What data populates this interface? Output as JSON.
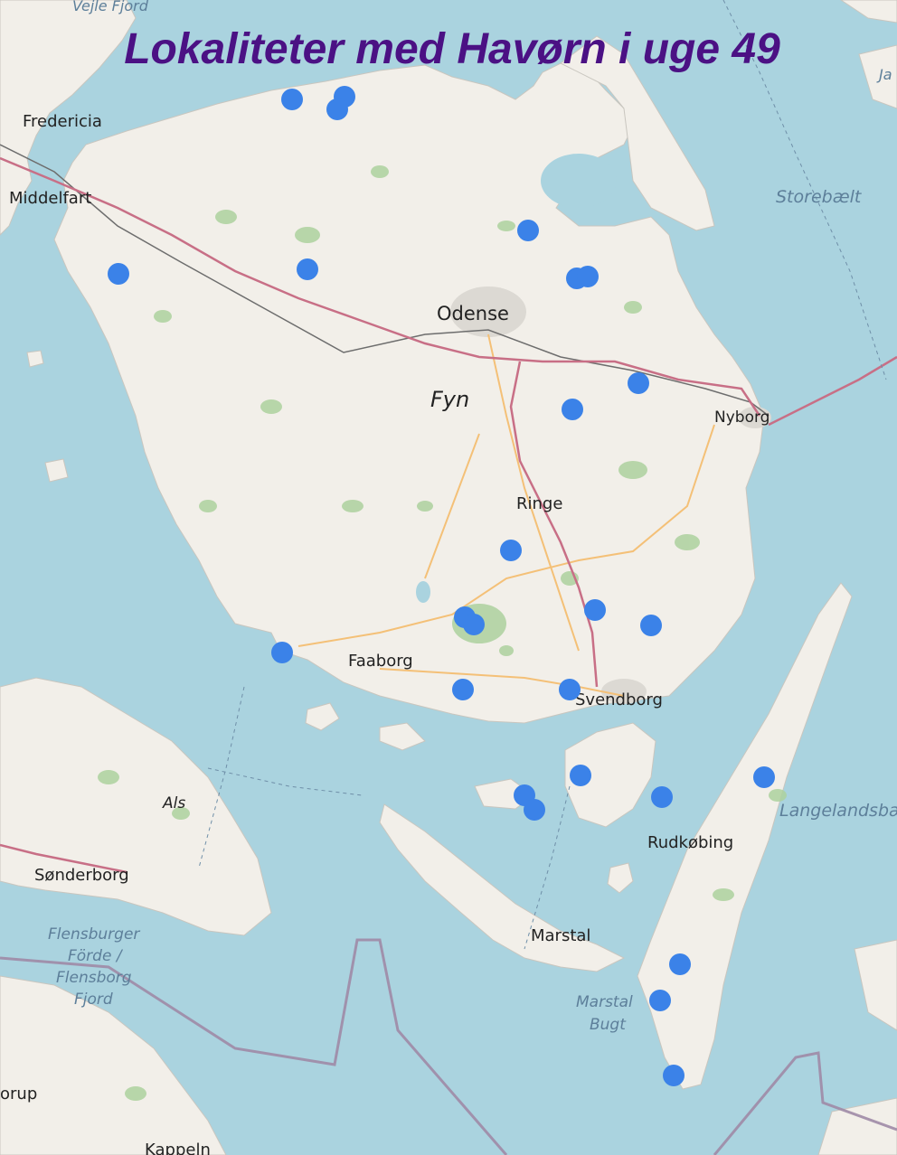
{
  "title": "Lokaliteter med Havørn i uge 49",
  "colors": {
    "sea": "#aad3df",
    "land": "#f2efe9",
    "forest": "#add19e",
    "marker": "#3b82e8",
    "title": "#4b1184",
    "motorway": "#c86f86",
    "railway": "#6d6d6d",
    "road": "#f4c077",
    "border": "#9e8aa6"
  },
  "labels": {
    "vejle_fjord": "Vejle Fjord",
    "fredericia": "Fredericia",
    "middelfart": "Middelfart",
    "odense": "Odense",
    "fyn": "Fyn",
    "nyborg": "Nyborg",
    "storebaelt": "Storebælt",
    "ringe": "Ringe",
    "faaborg": "Faaborg",
    "svendborg": "Svendborg",
    "als": "Als",
    "sonderborg": "Sønderborg",
    "rudkobing": "Rudkøbing",
    "langelandsbaelt": "Langelandsbælt",
    "marstal": "Marstal",
    "marstal_bugt_1": "Marstal",
    "marstal_bugt_2": "Bugt",
    "flensburger_1": "Flensburger",
    "flensburger_2": "Förde /",
    "flensburger_3": "Flensborg",
    "flensburger_4": "Fjord",
    "ja": "Ja",
    "orup": "orup",
    "kappeln": "Kappeln"
  }
}
